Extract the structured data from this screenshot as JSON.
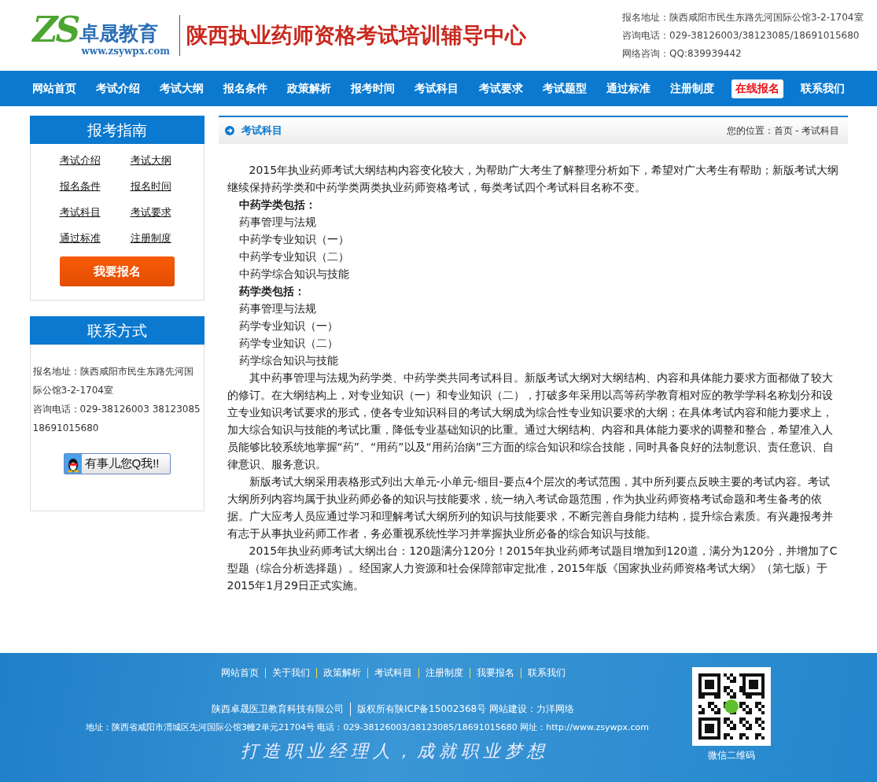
{
  "header": {
    "logo_letters": "ZS",
    "logo_name": "卓晟教育",
    "logo_url": "www.zsywpx.com",
    "title": "陕西执业药师资格考试培训辅导中心",
    "contact_lines": [
      "报名地址：陕西咸阳市民生东路先河国际公馆3-2-1704室",
      "咨询电话：029-38126003/38123085/18691015680",
      "网络咨询：QQ:839939442"
    ]
  },
  "nav": [
    {
      "label": "网站首页",
      "kind": "normal"
    },
    {
      "label": "考试介绍",
      "kind": "normal"
    },
    {
      "label": "考试大纲",
      "kind": "normal"
    },
    {
      "label": "报名条件",
      "kind": "normal"
    },
    {
      "label": "政策解析",
      "kind": "normal"
    },
    {
      "label": "报考时间",
      "kind": "normal"
    },
    {
      "label": "考试科目",
      "kind": "normal"
    },
    {
      "label": "考试要求",
      "kind": "normal"
    },
    {
      "label": "考试题型",
      "kind": "normal"
    },
    {
      "label": "通过标准",
      "kind": "normal"
    },
    {
      "label": "注册制度",
      "kind": "normal"
    },
    {
      "label": "在线报名",
      "kind": "highlight"
    },
    {
      "label": "联系我们",
      "kind": "normal"
    }
  ],
  "sidebar": {
    "guide": {
      "title": "报考指南",
      "links": [
        "考试介绍",
        "考试大纲",
        "报名条件",
        "报名时间",
        "考试科目",
        "考试要求",
        "通过标准",
        "注册制度"
      ],
      "button": "我要报名"
    },
    "contact": {
      "title": "联系方式",
      "lines": [
        "报名地址：陕西咸阳市民生东路先河国际公馆3-2-1704室",
        "咨询电话：029-38126003 38123085 18691015680"
      ],
      "qq_button": "有事儿您Q我!!"
    }
  },
  "main": {
    "title": "考试科目",
    "breadcrumb": "您的位置：首页 - 考试科目",
    "blocks": [
      {
        "kind": "paragraph",
        "text": "2015年执业药师考试大纲结构内容变化较大，为帮助广大考生了解整理分析如下，希望对广大考生有帮助；新版考试大纲继续保持药学类和中药学类两类执业药师资格考试，每类考试四个考试科目名称不变。"
      },
      {
        "kind": "heading",
        "text": "中药学类包括："
      },
      {
        "kind": "line",
        "text": "药事管理与法规"
      },
      {
        "kind": "line",
        "text": "中药学专业知识（一）"
      },
      {
        "kind": "line",
        "text": "中药学专业知识（二）"
      },
      {
        "kind": "line",
        "text": "中药学综合知识与技能"
      },
      {
        "kind": "heading",
        "text": "药学类包括："
      },
      {
        "kind": "line",
        "text": "药事管理与法规"
      },
      {
        "kind": "line",
        "text": "药学专业知识（一）"
      },
      {
        "kind": "line",
        "text": "药学专业知识（二）"
      },
      {
        "kind": "line",
        "text": "药学综合知识与技能"
      },
      {
        "kind": "paragraph",
        "text": "其中药事管理与法规为药学类、中药学类共同考试科目。新版考试大纲对大纲结构、内容和具体能力要求方面都做了较大的修订。在大纲结构上，对专业知识（一）和专业知识（二），打破多年采用以高等药学教育相对应的教学学科名称划分和设立专业知识考试要求的形式，使各专业知识科目的考试大纲成为综合性专业知识要求的大纲；在具体考试内容和能力要求上，加大综合知识与技能的考试比重，降低专业基础知识的比重。通过大纲结构、内容和具体能力要求的调整和整合，希望准入人员能够比较系统地掌握“药”、“用药”以及“用药治病”三方面的综合知识和综合技能，同时具备良好的法制意识、责任意识、自律意识、服务意识。"
      },
      {
        "kind": "paragraph",
        "text": "新版考试大纲采用表格形式列出大单元-小单元-细目-要点4个层次的考试范围，其中所列要点反映主要的考试内容。考试大纲所列内容均属于执业药师必备的知识与技能要求，统一纳入考试命题范围，作为执业药师资格考试命题和考生备考的依据。广大应考人员应通过学习和理解考试大纲所列的知识与技能要求，不断完善自身能力结构，提升综合素质。有兴趣报考并有志于从事执业药师工作者，务必重视系统性学习并掌握执业所必备的综合知识与技能。"
      },
      {
        "kind": "paragraph",
        "text": "2015年执业药师考试大纲出台：120题满分120分！2015年执业药师考试题目增加到120道，满分为120分，并增加了C型题（综合分析选择题）。经国家人力资源和社会保障部审定批准，2015年版《国家执业药师资格考试大纲》（第七版）于2015年1月29日正式实施。"
      }
    ]
  },
  "footer": {
    "links": [
      "网站首页",
      "关于我们",
      "政策解析",
      "考试科目",
      "注册制度",
      "我要报名",
      "联系我们"
    ],
    "company_parts": [
      "陕西卓晟医卫教育科技有限公司",
      "版权所有陕ICP备15002368号 网站建设：力洋网络"
    ],
    "address": "地址：陕西省咸阳市渭城区先河国际公馆3幢2单元21704号 电话：029-38126003/38123085/18691015680 网址：http://www.zsywpx.com",
    "slogan": "打造职业经理人，成就职业梦想",
    "qr_caption": "微信二维码"
  }
}
